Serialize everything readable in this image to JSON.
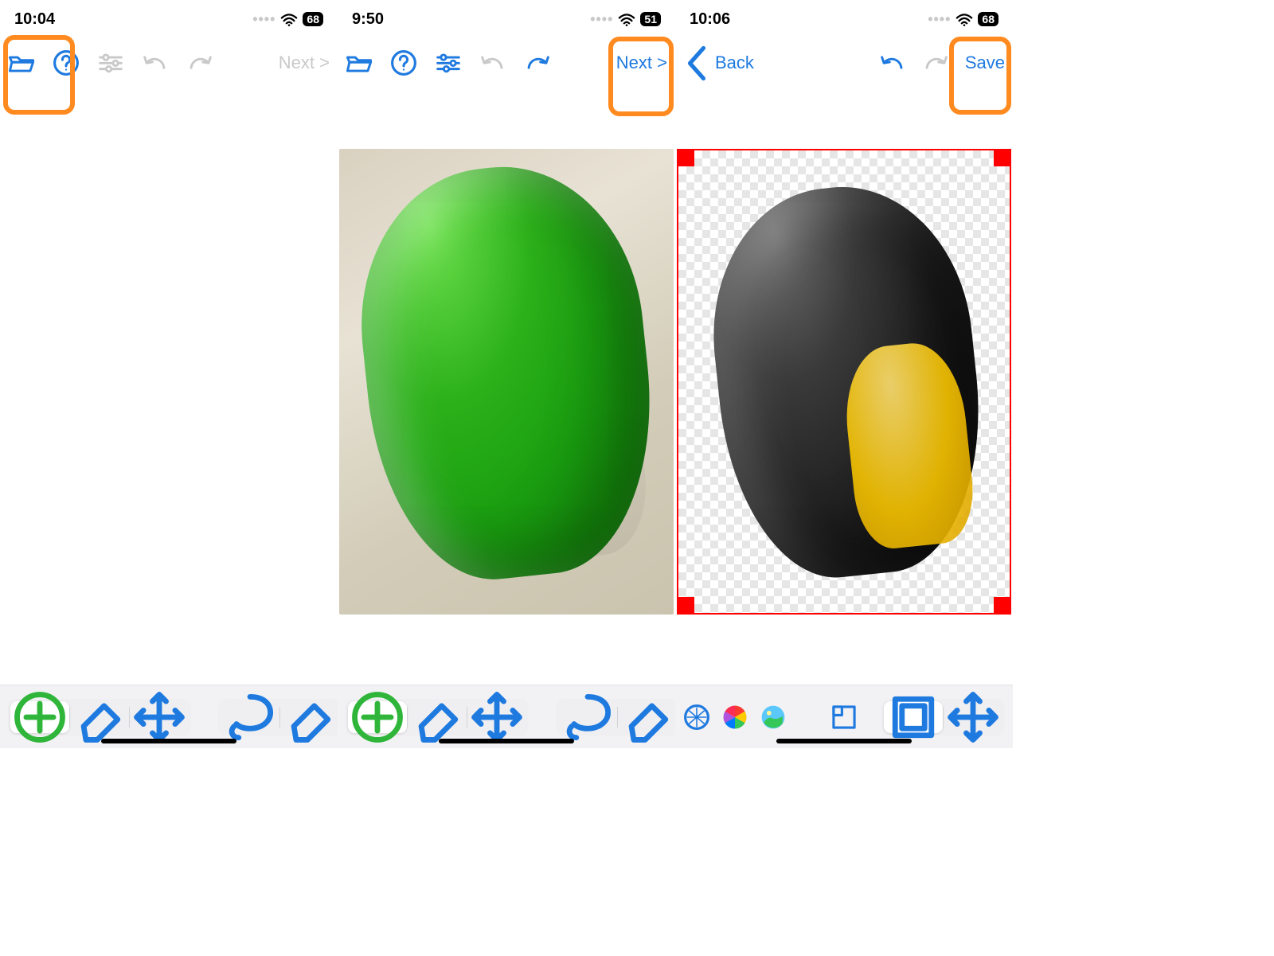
{
  "screens": [
    {
      "status": {
        "time": "10:04",
        "battery": "68"
      },
      "toolbar": {
        "next_label": "Next >"
      },
      "highlight": "open-folder",
      "bottom": {
        "left_group": [
          "add-icon",
          "eraser-icon",
          "move-icon"
        ],
        "right_group": [
          "lasso-icon",
          "eraser2-icon"
        ]
      }
    },
    {
      "status": {
        "time": "9:50",
        "battery": "51"
      },
      "toolbar": {
        "next_label": "Next >"
      },
      "highlight": "next-button",
      "bottom": {
        "left_group": [
          "add-icon",
          "eraser-icon",
          "move-icon"
        ],
        "right_group": [
          "lasso-icon",
          "eraser2-icon"
        ]
      }
    },
    {
      "status": {
        "time": "10:06",
        "battery": "68"
      },
      "toolbar": {
        "back_label": "Back",
        "save_label": "Save"
      },
      "highlight": "save-button",
      "bottom": {
        "left_group": [
          "transparency-icon",
          "color-wheel-icon",
          "image-icon"
        ],
        "mid_group": [
          "canvas-size-icon"
        ],
        "right_group": [
          "crop-icon",
          "move-icon"
        ]
      }
    }
  ]
}
